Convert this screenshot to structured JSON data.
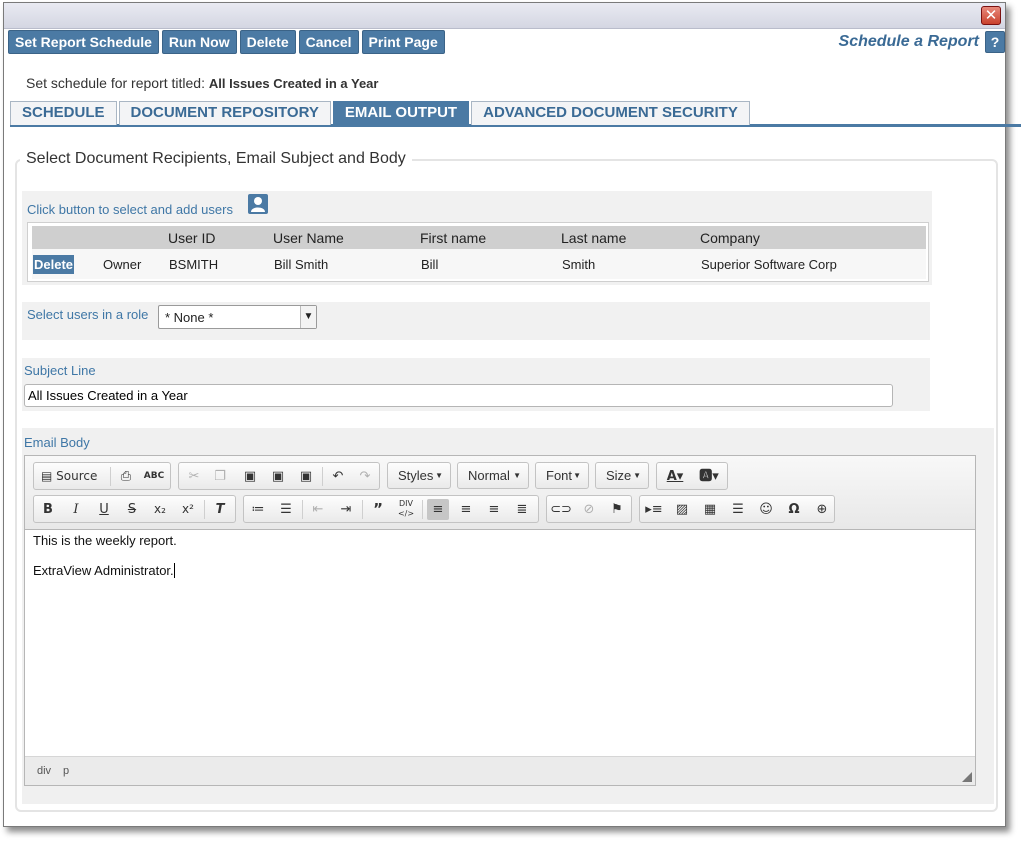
{
  "window": {
    "close_symbol": "✕"
  },
  "toolbar": {
    "buttons": [
      "Set Report Schedule",
      "Run Now",
      "Delete",
      "Cancel",
      "Print Page"
    ],
    "page_title": "Schedule a Report",
    "help_label": "?"
  },
  "report": {
    "prefix": "Set schedule for report titled:",
    "title": "All Issues Created in a Year"
  },
  "tabs": [
    "SCHEDULE",
    "DOCUMENT REPOSITORY",
    "EMAIL OUTPUT",
    "ADVANCED DOCUMENT SECURITY"
  ],
  "active_tab": "EMAIL OUTPUT",
  "section_legend": "Select Document Recipients, Email Subject and Body",
  "users": {
    "hint": "Click button to select and add users",
    "add_icon": "add-user-icon",
    "columns": [
      "",
      "",
      "User ID",
      "User Name",
      "First name",
      "Last name",
      "Company"
    ],
    "rows": [
      {
        "action": "Delete",
        "role": "Owner",
        "user_id": "BSMITH",
        "user_name": "Bill Smith",
        "first_name": "Bill",
        "last_name": "Smith",
        "company": "Superior Software Corp"
      }
    ]
  },
  "role": {
    "label": "Select users in a role",
    "selected": "* None *"
  },
  "subject": {
    "label": "Subject Line",
    "value": "All Issues Created in a Year"
  },
  "email_body": {
    "label": "Email Body",
    "toolbar": {
      "source": "Source",
      "styles": "Styles",
      "format": "Normal",
      "font": "Font",
      "size": "Size"
    },
    "paragraphs": [
      "This is the weekly report.",
      "ExtraView Administrator."
    ],
    "path": [
      "div",
      "p"
    ]
  },
  "colors": {
    "accent": "#4b7aa4",
    "title": "#3a6a95",
    "label": "#3f77a6"
  }
}
